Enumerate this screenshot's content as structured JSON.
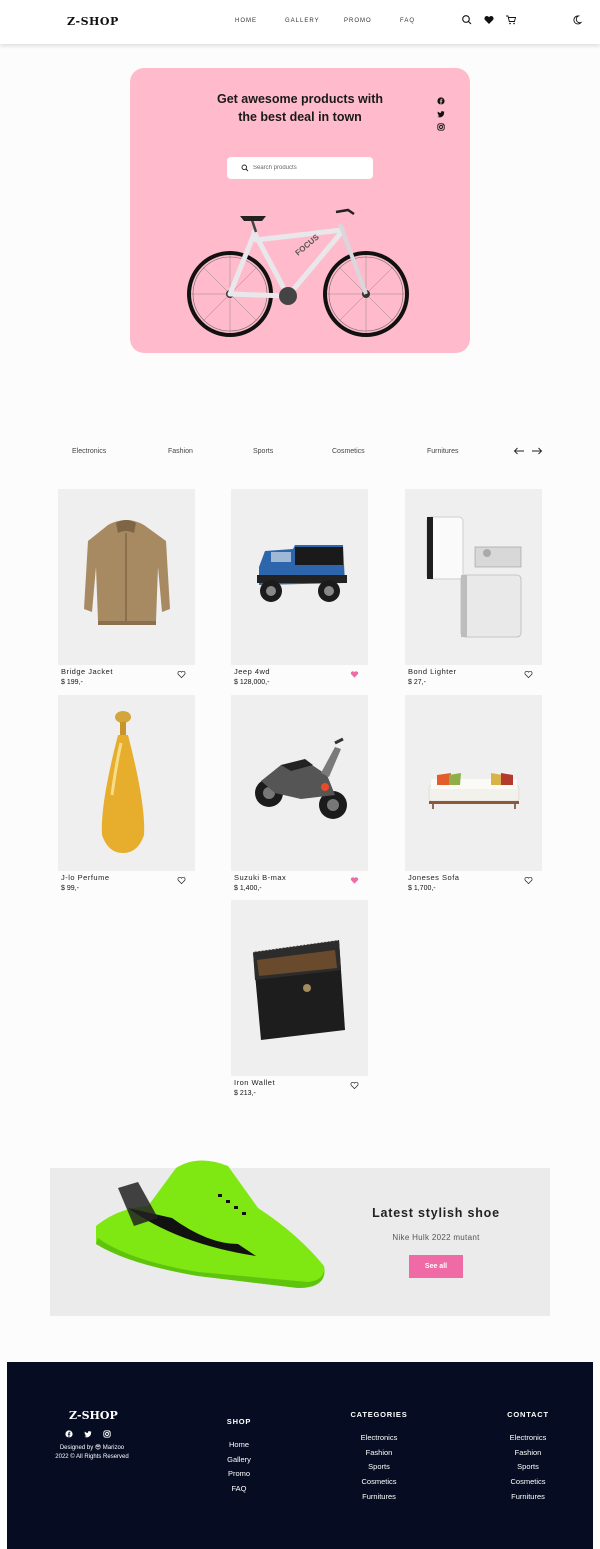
{
  "nav": {
    "logo": "Z-SHOP",
    "links": [
      "HOME",
      "GALLERY",
      "PROMO",
      "FAQ"
    ],
    "icons": [
      "search-icon",
      "heart-icon",
      "cart-icon",
      "moon-icon"
    ]
  },
  "hero": {
    "title": "Get awesome products with the best deal in town",
    "search_placeholder": "Search products",
    "social": [
      "facebook-icon",
      "twitter-icon",
      "instagram-icon"
    ],
    "bg_color": "#ffbbcb"
  },
  "categories": [
    "Electronics",
    "Fashion",
    "Sports",
    "Cosmetics",
    "Furnitures"
  ],
  "products": [
    {
      "name": "Bridge Jacket",
      "price": "$ 199,-",
      "liked": false
    },
    {
      "name": "Jeep 4wd",
      "price": "$ 128,000,-",
      "liked": true
    },
    {
      "name": "Bond Lighter",
      "price": "$ 27,-",
      "liked": false
    },
    {
      "name": "J-lo Perfume",
      "price": "$ 99,-",
      "liked": false
    },
    {
      "name": "Suzuki B-max",
      "price": "$ 1,400,-",
      "liked": true
    },
    {
      "name": "Joneses Sofa",
      "price": "$ 1,700,-",
      "liked": false
    },
    {
      "name": "Iron Wallet",
      "price": "$ 213,-",
      "liked": false
    }
  ],
  "promo": {
    "title": "Latest stylish shoe",
    "subtitle": "Nike Hulk 2022 mutant",
    "button": "See all",
    "accent": "#f06aa6"
  },
  "footer": {
    "logo": "Z-SHOP",
    "designed_by": "Designed by 😎 Marizoo",
    "copyright": "2022 © All Rights Reserved",
    "shop": {
      "heading": "SHOP",
      "items": [
        "Home",
        "Gallery",
        "Promo",
        "FAQ"
      ]
    },
    "categories": {
      "heading": "CATEGORIES",
      "items": [
        "Electronics",
        "Fashion",
        "Sports",
        "Cosmetics",
        "Furnitures"
      ]
    },
    "contact": {
      "heading": "CONTACT",
      "items": [
        "Electronics",
        "Fashion",
        "Sports",
        "Cosmetics",
        "Furnitures"
      ]
    },
    "bg_color": "#060d22"
  }
}
